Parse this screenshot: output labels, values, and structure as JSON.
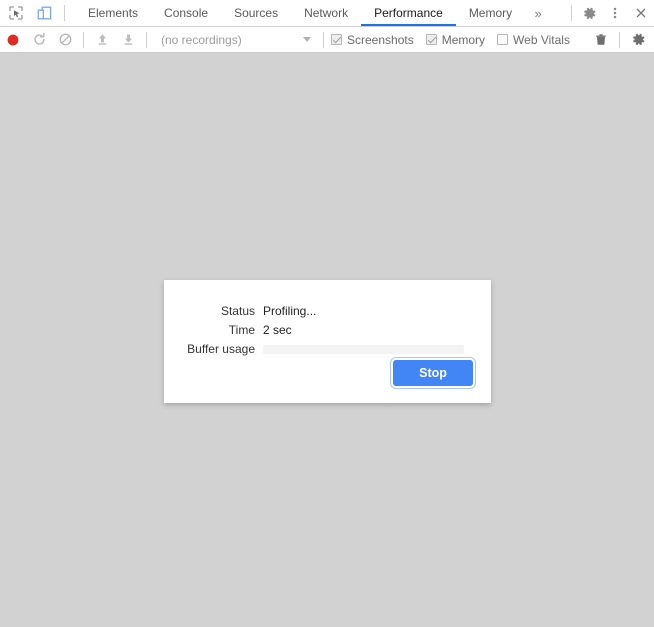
{
  "tabbar": {
    "inspect_icon": "inspect-cursor-icon",
    "device_icon": "device-toolbar-icon",
    "tabs": [
      {
        "label": "Elements",
        "active": false
      },
      {
        "label": "Console",
        "active": false
      },
      {
        "label": "Sources",
        "active": false
      },
      {
        "label": "Network",
        "active": false
      },
      {
        "label": "Performance",
        "active": true
      },
      {
        "label": "Memory",
        "active": false
      }
    ],
    "more_tabs_label": "»",
    "settings_icon": "gear-icon",
    "menu_icon": "kebab-menu-icon",
    "close_icon": "close-icon",
    "accent_color": "#1a73e8"
  },
  "toolbar": {
    "record_icon": "record-circle-icon",
    "reload_record_icon": "reload-and-record-icon",
    "clear_icon": "clear-no-entry-icon",
    "load_icon": "upload-arrow-icon",
    "save_icon": "download-arrow-icon",
    "recordings_placeholder": "(no recordings)",
    "recordings_caret_icon": "chevron-down-icon",
    "checkboxes": [
      {
        "label": "Screenshots",
        "checked": true
      },
      {
        "label": "Memory",
        "checked": true
      },
      {
        "label": "Web Vitals",
        "checked": false
      }
    ],
    "trash_icon": "trash-icon",
    "settings_icon": "gear-icon",
    "record_color": "#e53935"
  },
  "dialog": {
    "rows": [
      {
        "label": "Status",
        "value": "Profiling..."
      },
      {
        "label": "Time",
        "value": "2 sec"
      }
    ],
    "buffer_label": "Buffer usage",
    "buffer_percent": 0,
    "stop_label": "Stop",
    "button_color": "#4285f4"
  }
}
